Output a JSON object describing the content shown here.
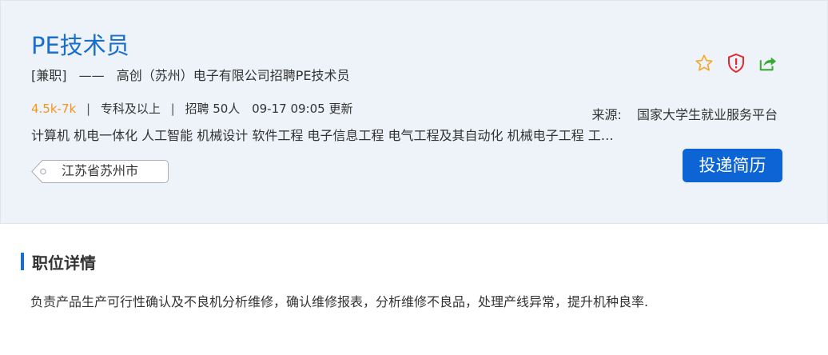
{
  "job": {
    "title": "PE技术员",
    "type": "[兼职]",
    "dash": "——",
    "company_line": "高创（苏州）电子有限公司招聘PE技术员",
    "salary": "4.5k-7k",
    "separator": "|",
    "education": "专科及以上",
    "headcount": "招聘 50人",
    "update_date": "09-17 09:05",
    "update_label": "更新",
    "majors": "计算机 机电一体化 人工智能 机械设计 软件工程 电子信息工程 电气工程及其自动化 机械电子工程 工…",
    "location": "江苏省苏州市"
  },
  "source": {
    "label": "来源:",
    "name": "国家大学生就业服务平台"
  },
  "actions": {
    "favorite_icon": "star-icon",
    "report_icon": "shield-alert-icon",
    "share_icon": "share-icon",
    "apply_label": "投递简历"
  },
  "details": {
    "section_title": "职位详情",
    "description": "负责产品生产可行性确认及不良机分析维修，确认维修报表，分析维修不良品，处理产线异常，提升机种良率."
  },
  "colors": {
    "accent_blue": "#1a6fc9",
    "button_blue": "#0c64d5",
    "salary_orange": "#f7941d",
    "star_orange": "#f5a623",
    "report_red": "#e8262d",
    "share_green": "#3aa935",
    "panel_bg": "#edf3f9"
  }
}
